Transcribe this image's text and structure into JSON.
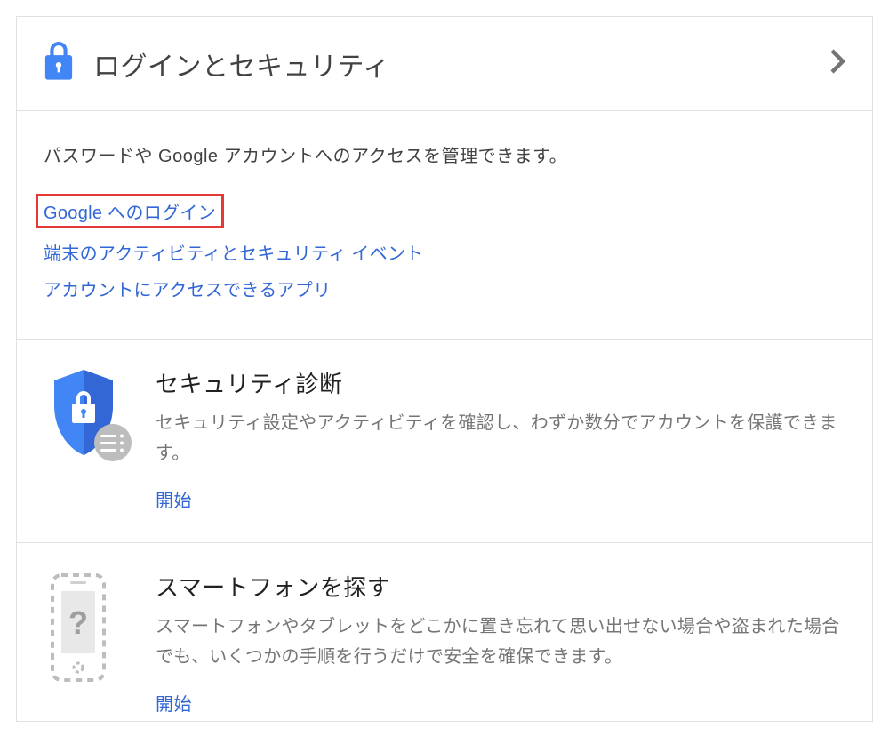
{
  "header": {
    "title": "ログインとセキュリティ"
  },
  "body": {
    "description": "パスワードや Google アカウントへのアクセスを管理できます。",
    "links": [
      "Google へのログイン",
      "端末のアクティビティとセキュリティ イベント",
      "アカウントにアクセスできるアプリ"
    ]
  },
  "sections": [
    {
      "title": "セキュリティ診断",
      "desc": "セキュリティ設定やアクティビティを確認し、わずか数分でアカウントを保護できます。",
      "action": "開始"
    },
    {
      "title": "スマートフォンを探す",
      "desc": "スマートフォンやタブレットをどこかに置き忘れて思い出せない場合や盗まれた場合でも、いくつかの手順を行うだけで安全を確保できます。",
      "action": "開始"
    }
  ]
}
